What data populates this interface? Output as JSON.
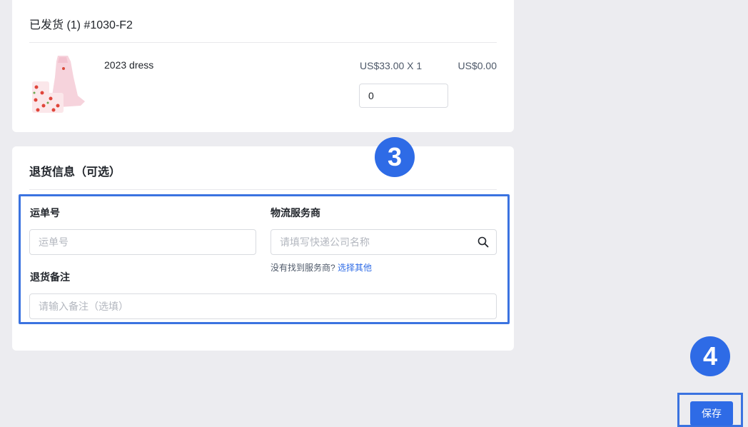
{
  "shipped": {
    "title": "已发货 (1) #1030-F2",
    "product": {
      "name": "2023 dress",
      "unit_price": "US$33.00 X 1",
      "total": "US$0.00",
      "quantity": "0",
      "image": "dress-thumbnail"
    }
  },
  "returns": {
    "title": "退货信息（可选）",
    "tracking": {
      "label": "运单号",
      "placeholder": "运单号"
    },
    "carrier": {
      "label": "物流服务商",
      "placeholder": "请填写快递公司名称",
      "icon": "search-icon"
    },
    "carrier_hint": {
      "text": "没有找到服务商?",
      "link": "选择其他"
    },
    "note": {
      "label": "退货备注",
      "placeholder": "请输入备注（选填）"
    }
  },
  "annotations": {
    "step3": "3",
    "step4": "4"
  },
  "actions": {
    "save_label": "保存"
  },
  "colors": {
    "accent": "#2e6be6",
    "highlight": "#3b73e0",
    "background": "#ececf0"
  }
}
